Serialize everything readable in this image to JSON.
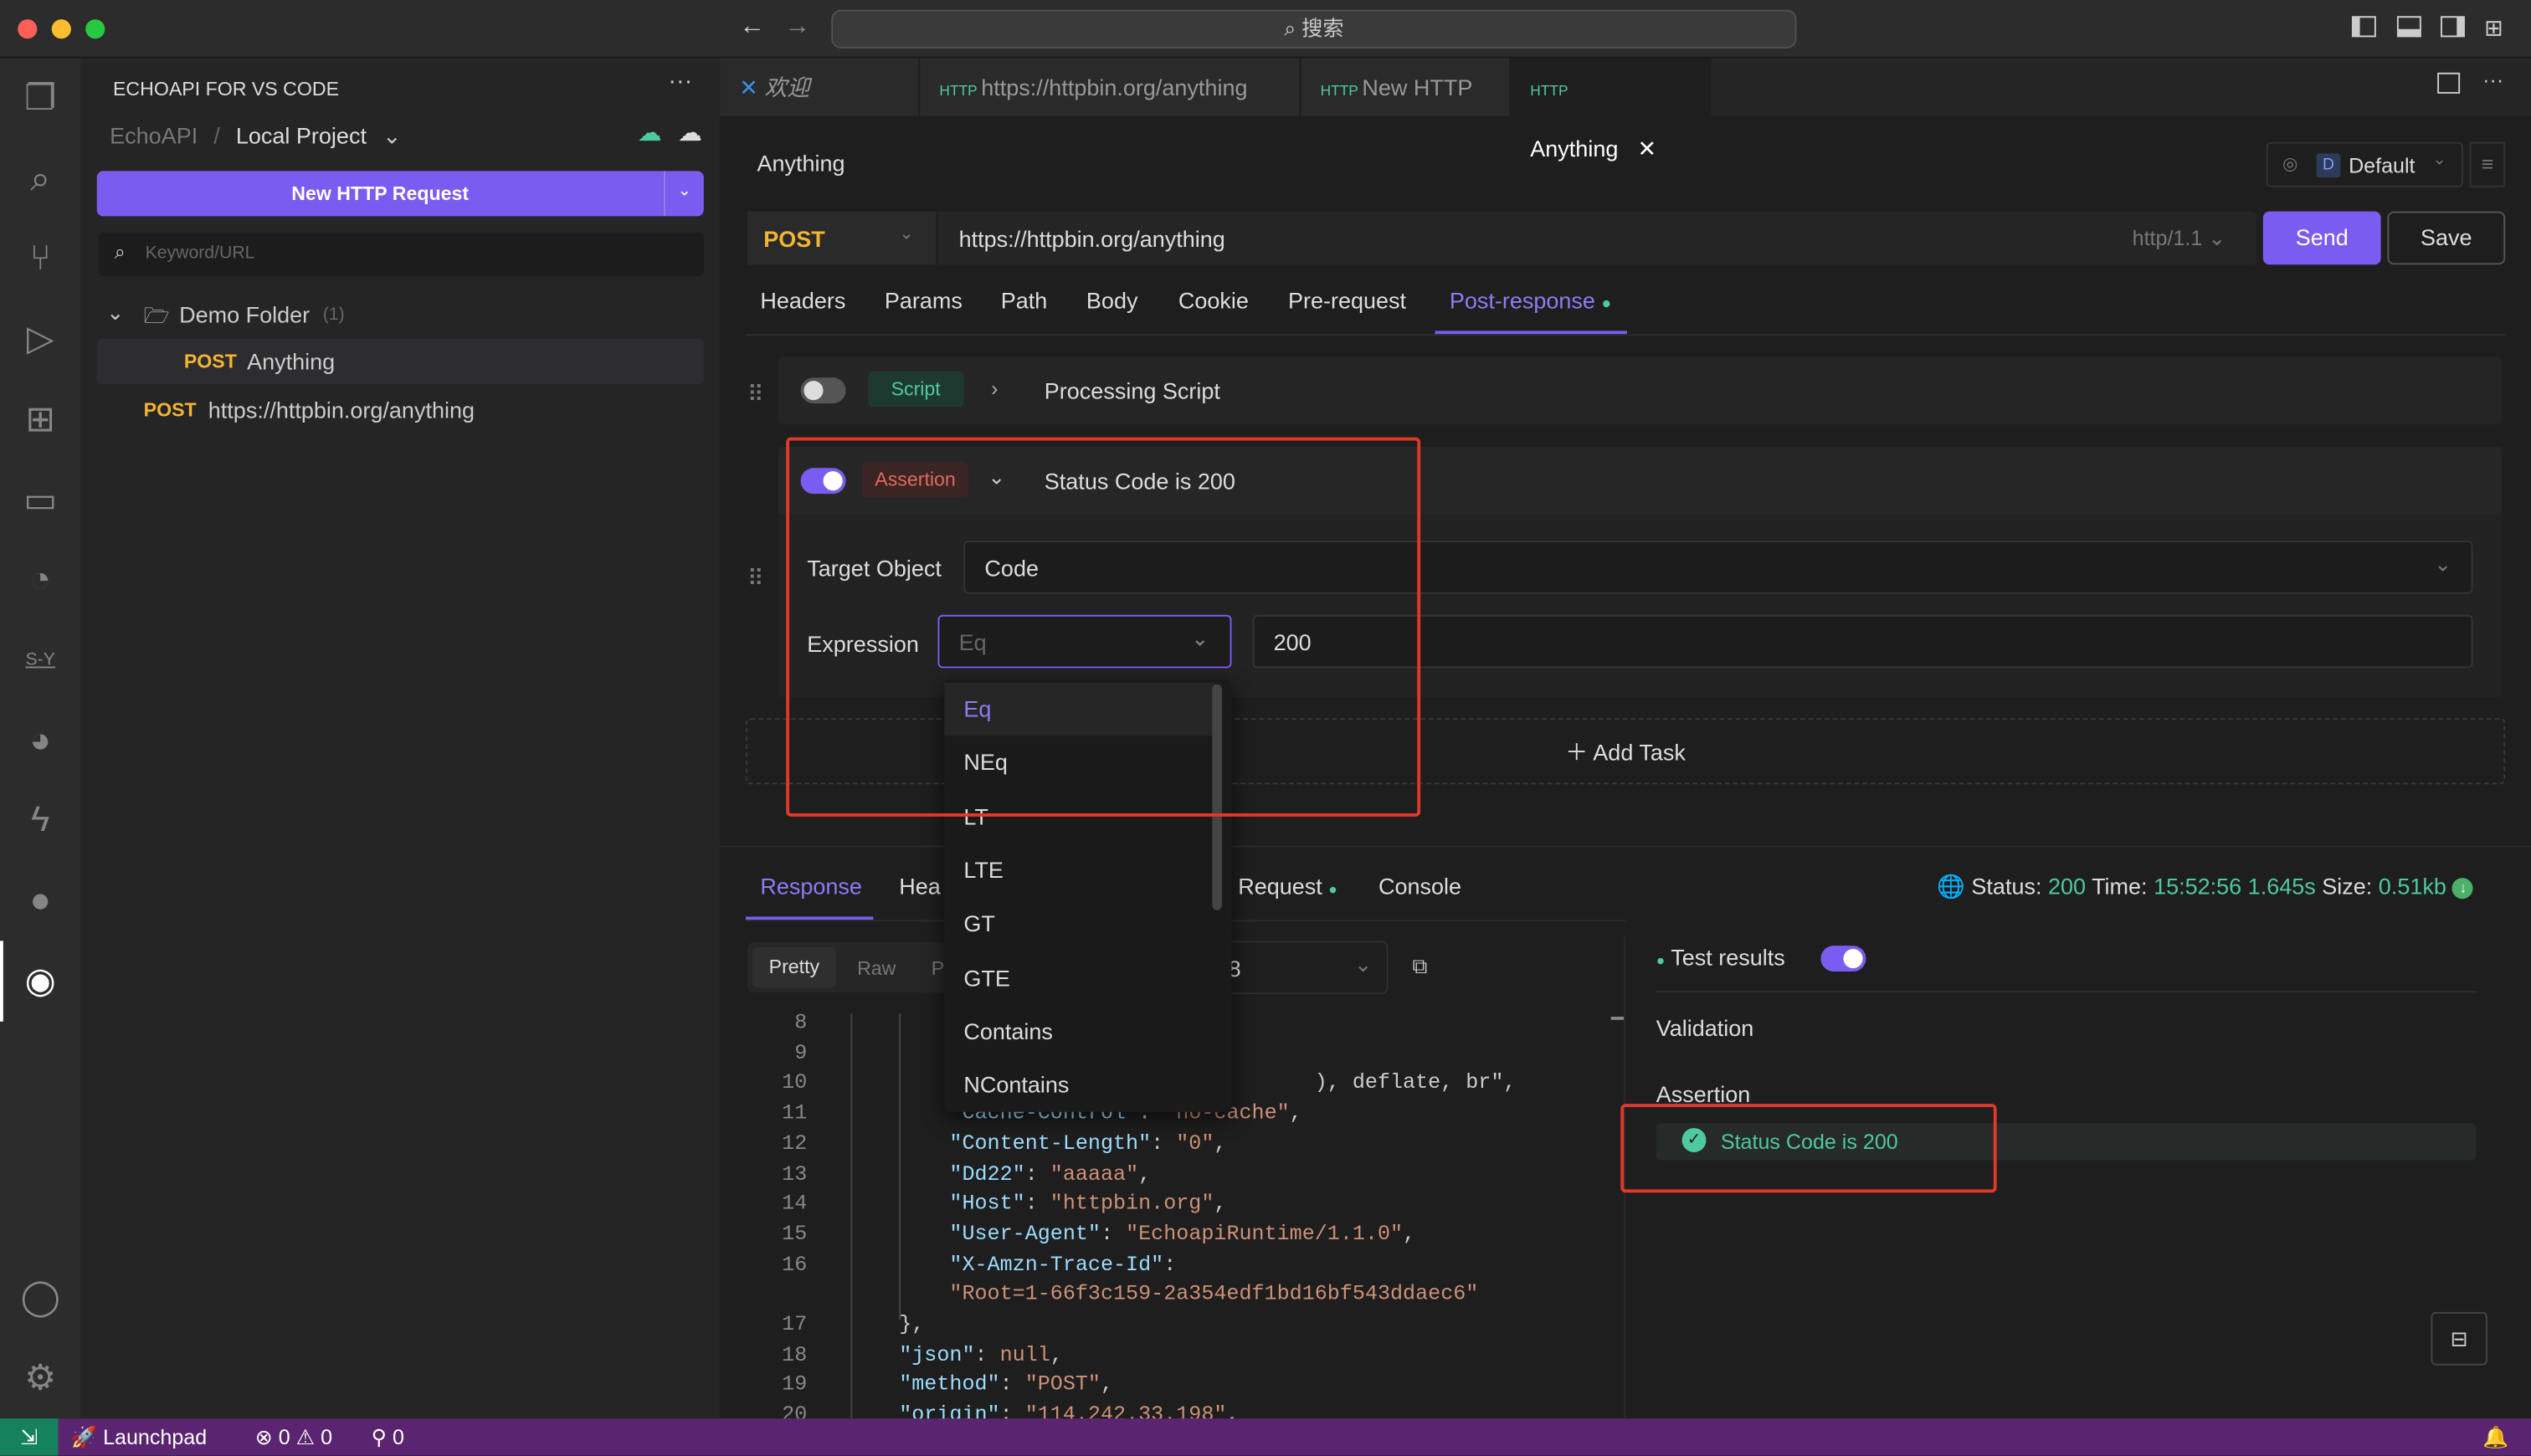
{
  "window": {
    "search_placeholder": "搜索"
  },
  "colors": {
    "accent": "#7b5cf0",
    "method_post": "#f5b432",
    "success": "#4ec9a0",
    "highlight_box": "#e0392b",
    "status_bar": "#5a2470"
  },
  "sidebar": {
    "title": "ECHOAPI FOR VS CODE",
    "breadcrumb_root": "EchoAPI",
    "breadcrumb_separator": "/",
    "project": "Local Project",
    "new_request_label": "New HTTP Request",
    "search_placeholder": "Keyword/URL",
    "folder": {
      "name": "Demo Folder",
      "count": "(1)"
    },
    "items": [
      {
        "method": "POST",
        "name": "Anything"
      },
      {
        "method": "POST",
        "name": "https://httpbin.org/anything"
      }
    ]
  },
  "tabs": [
    {
      "label": "欢迎",
      "icon": "vscode-icon"
    },
    {
      "label": "https://httpbin.org/anything",
      "icon": "http-icon"
    },
    {
      "label": "New HTTP",
      "icon": "http-icon"
    },
    {
      "label": "Anything",
      "icon": "http-icon",
      "active": true
    }
  ],
  "request": {
    "title": "Anything",
    "environment_badge": "D",
    "environment": "Default",
    "method": "POST",
    "url": "https://httpbin.org/anything",
    "protocol": "http/1.1",
    "send_label": "Send",
    "save_label": "Save",
    "subtabs": [
      "Headers",
      "Params",
      "Path",
      "Body",
      "Cookie",
      "Pre-request",
      "Post-response"
    ],
    "active_subtab": "Post-response"
  },
  "post_response": {
    "script_row": {
      "tag": "Script",
      "title": "Processing Script",
      "enabled": false
    },
    "assertion_row": {
      "tag": "Assertion",
      "title": "Status Code is 200",
      "enabled": true
    },
    "target_label": "Target Object",
    "target_value": "Code",
    "expression_label": "Expression",
    "expression_value": "Eq",
    "expected_value": "200",
    "add_task_label": "Add Task",
    "dropdown_options": [
      "Eq",
      "NEq",
      "LT",
      "LTE",
      "GT",
      "GTE",
      "Contains",
      "NContains"
    ],
    "dropdown_selected": "Eq"
  },
  "response": {
    "tabs": [
      "Response",
      "Hea",
      "Request",
      "Console"
    ],
    "active_tab": "Response",
    "status_label": "Status:",
    "status": "200",
    "time_label": "Time:",
    "time": "15:52:56",
    "duration": "1.645s",
    "size_label": "Size:",
    "size": "0.51kb",
    "view_modes": [
      "Pretty",
      "Raw",
      "P"
    ],
    "encoding_fragment": "8",
    "code_lines": [
      {
        "n": "8",
        "t": ""
      },
      {
        "n": "9",
        "t": ""
      },
      {
        "n": "10",
        "t": "                                 ), deflate, br\","
      },
      {
        "n": "11",
        "t": "    \"Cache-Control\": \"no-cache\","
      },
      {
        "n": "12",
        "t": "    \"Content-Length\": \"0\","
      },
      {
        "n": "13",
        "t": "    \"Dd22\": \"aaaaa\","
      },
      {
        "n": "14",
        "t": "    \"Host\": \"httpbin.org\","
      },
      {
        "n": "15",
        "t": "    \"User-Agent\": \"EchoapiRuntime/1.1.0\","
      },
      {
        "n": "16",
        "t": "    \"X-Amzn-Trace-Id\":"
      },
      {
        "n": "",
        "t": "    \"Root=1-66f3c159-2a354edf1bd16bf543ddaec6\""
      },
      {
        "n": "17",
        "t": "},"
      },
      {
        "n": "18",
        "t": "\"json\": null,"
      },
      {
        "n": "19",
        "t": "\"method\": \"POST\","
      },
      {
        "n": "20",
        "t": "\"origin\": \"114.242.33.198\","
      }
    ],
    "test_results_label": "Test results",
    "validation_label": "Validation",
    "assertion_label": "Assertion",
    "assertion_result": "Status Code is 200"
  },
  "statusbar": {
    "launchpad": "Launchpad",
    "errors": "0",
    "warnings": "0",
    "ports": "0"
  }
}
